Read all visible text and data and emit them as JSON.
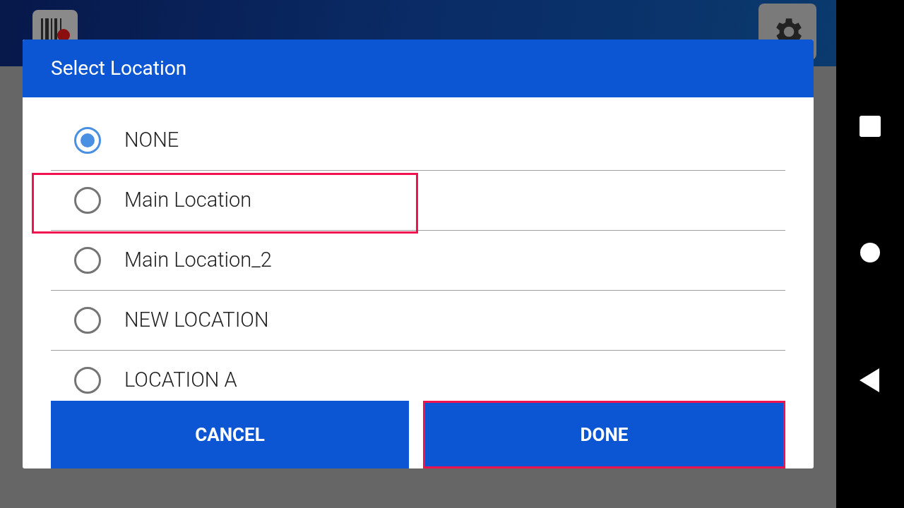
{
  "dialog": {
    "title": "Select Location",
    "options": [
      {
        "label": "NONE",
        "selected": true,
        "highlighted": false
      },
      {
        "label": "Main Location",
        "selected": false,
        "highlighted": true
      },
      {
        "label": "Main Location_2",
        "selected": false,
        "highlighted": false
      },
      {
        "label": "NEW LOCATION",
        "selected": false,
        "highlighted": false
      },
      {
        "label": "LOCATION A",
        "selected": false,
        "highlighted": false
      }
    ],
    "buttons": [
      {
        "label": "CANCEL",
        "highlighted": false
      },
      {
        "label": "DONE",
        "highlighted": true
      }
    ]
  }
}
